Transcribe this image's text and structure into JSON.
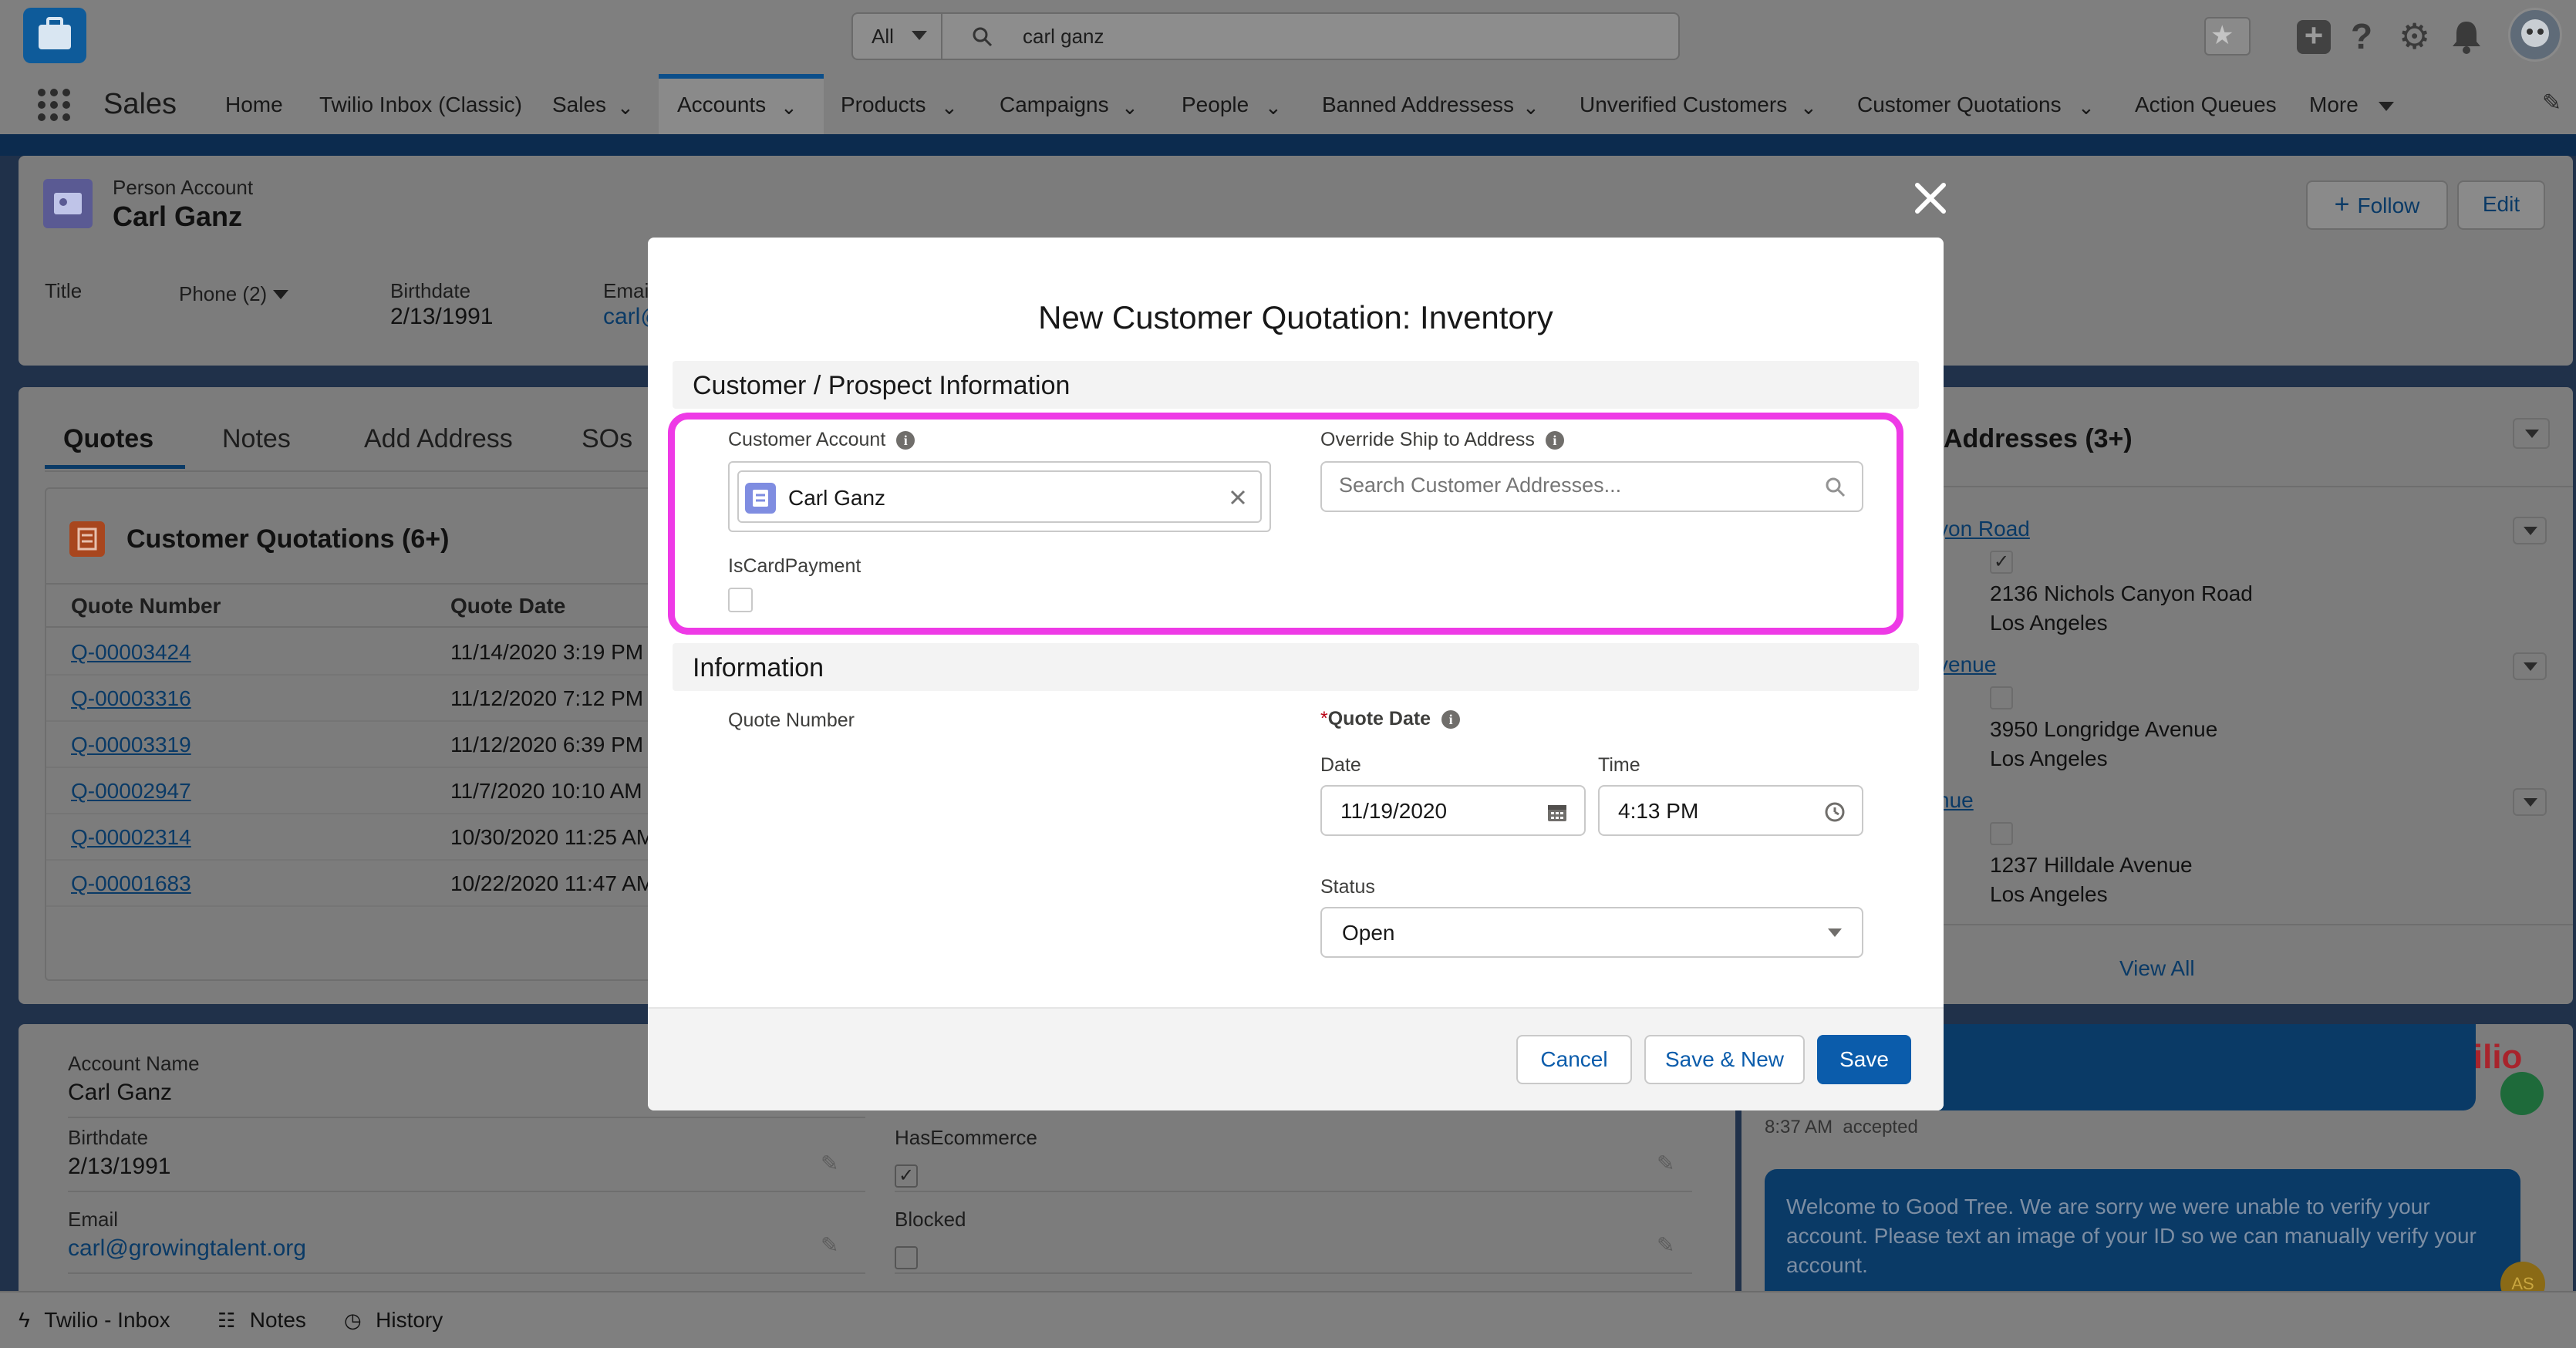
{
  "global": {
    "search_scope": "All",
    "search_value": "carl ganz"
  },
  "nav": {
    "app_name": "Sales",
    "items": [
      {
        "label": "Home"
      },
      {
        "label": "Twilio Inbox (Classic)"
      },
      {
        "label": "Sales"
      },
      {
        "label": "Accounts"
      },
      {
        "label": "Products"
      },
      {
        "label": "Campaigns"
      },
      {
        "label": "People"
      },
      {
        "label": "Banned Addressess"
      },
      {
        "label": "Unverified Customers"
      },
      {
        "label": "Customer Quotations"
      },
      {
        "label": "Action Queues"
      },
      {
        "label": "More"
      }
    ]
  },
  "record": {
    "type": "Person Account",
    "name": "Carl Ganz",
    "follow_label": "Follow",
    "edit_label": "Edit",
    "fields": {
      "title_label": "Title",
      "phone_label": "Phone (2)",
      "birthdate_label": "Birthdate",
      "birthdate_value": "2/13/1991",
      "email_label": "Email",
      "email_value": "carl@"
    }
  },
  "tabs": {
    "items": [
      "Quotes",
      "Notes",
      "Add Address",
      "SOs"
    ]
  },
  "quotations": {
    "title": "Customer Quotations (6+)",
    "col_number": "Quote Number",
    "col_date": "Quote Date",
    "rows": [
      {
        "number": "Q-00003424",
        "date": "11/14/2020 3:19 PM"
      },
      {
        "number": "Q-00003316",
        "date": "11/12/2020 7:12 PM"
      },
      {
        "number": "Q-00003319",
        "date": "11/12/2020 6:39 PM"
      },
      {
        "number": "Q-00002947",
        "date": "11/7/2020 10:10 AM"
      },
      {
        "number": "Q-00002314",
        "date": "10/30/2020 11:25 AM"
      },
      {
        "number": "Q-00001683",
        "date": "10/22/2020 11:47 AM"
      }
    ]
  },
  "addresses": {
    "title": "Addresses (3+)",
    "items": [
      {
        "link": "yon Road",
        "line1": "2136 Nichols Canyon Road",
        "line2": "Los Angeles",
        "checked": true
      },
      {
        "link": "venue",
        "line1": "3950 Longridge Avenue",
        "line2": "Los Angeles",
        "checked": false
      },
      {
        "link": "nue",
        "line1": "1237 Hilldale Avenue",
        "line2": "Los Angeles",
        "checked": false
      }
    ],
    "view_all": "View All"
  },
  "details": {
    "account_name_label": "Account Name",
    "account_name_value": "Carl Ganz",
    "birthdate_label": "Birthdate",
    "birthdate_value": "2/13/1991",
    "email_label": "Email",
    "email_value": "carl@growingtalent.org",
    "has_ecommerce_label": "HasEcommerce",
    "blocked_label": "Blocked"
  },
  "chat": {
    "brand": "twilio",
    "timestamp": "8:37 AM  accepted",
    "message": "Welcome to Good Tree. We are sorry we were unable to verify your account. Please text an image of your ID so we can manually verify your account.",
    "avatar_initials": "AS"
  },
  "bottom": {
    "items": [
      "Twilio - Inbox",
      "Notes",
      "History"
    ]
  },
  "modal": {
    "title": "New Customer Quotation: Inventory",
    "section1": "Customer / Prospect Information",
    "customer_account_label": "Customer Account",
    "customer_account_value": "Carl Ganz",
    "override_label": "Override Ship to Address",
    "override_placeholder": "Search Customer Addresses...",
    "is_card_label": "IsCardPayment",
    "section2": "Information",
    "quote_number_label": "Quote Number",
    "quote_date_label": "Quote Date",
    "required_mark": "*",
    "date_label": "Date",
    "date_value": "11/19/2020",
    "time_label": "Time",
    "time_value": "4:13 PM",
    "status_label": "Status",
    "status_value": "Open",
    "cancel_label": "Cancel",
    "save_new_label": "Save & New",
    "save_label": "Save"
  },
  "colors": {
    "brand_blue": "#0b5cab",
    "highlight": "#ee3ae6",
    "twilio_red": "#a8242c"
  }
}
